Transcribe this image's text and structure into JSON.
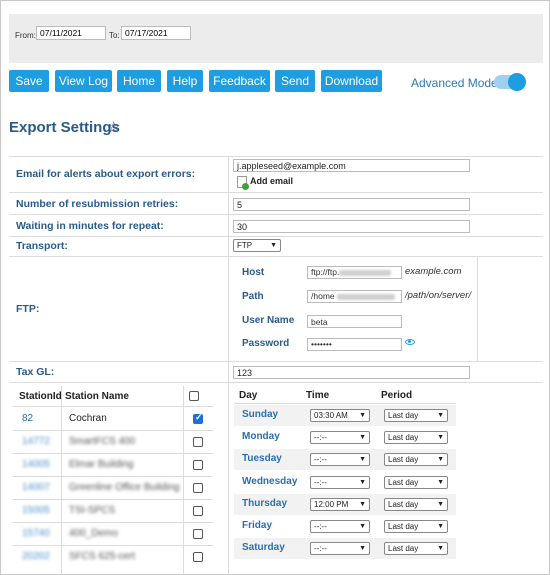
{
  "date_range": {
    "from_label": "From:",
    "from_value": "07/11/2021",
    "to_label": "To:",
    "to_value": "07/17/2021"
  },
  "toolbar": {
    "buttons": [
      "Save",
      "View Log",
      "Home",
      "Help",
      "Feedback",
      "Send",
      "Download"
    ],
    "advanced_mode_label": "Advanced Mode",
    "advanced_mode_on": true
  },
  "page": {
    "title": "Export Settings"
  },
  "settings": {
    "email_label": "Email for alerts about export errors:",
    "email_value": "j.appleseed@example.com",
    "add_email_label": "Add email",
    "retries_label": "Number of resubmission retries:",
    "retries_value": "5",
    "wait_label": "Waiting in minutes for repeat:",
    "wait_value": "30",
    "transport_label": "Transport:",
    "transport_value": "FTP",
    "ftp_label": "FTP:",
    "taxgl_label": "Tax GL:",
    "taxgl_value": "123"
  },
  "ftp": {
    "host_label": "Host",
    "host_value": "ftp://ftp.",
    "host_suffix": "example.com",
    "path_label": "Path",
    "path_value": "/home",
    "path_suffix": "/path/on/server/",
    "user_label": "User Name",
    "user_value": "beta",
    "password_label": "Password",
    "password_value": "•••••••"
  },
  "stations": {
    "col_id": "StationId",
    "col_name": "Station Name",
    "rows": [
      {
        "id": "82",
        "name": "Cochran",
        "checked": true
      },
      {
        "id": "14772",
        "name": "SmartFCS 400",
        "checked": false
      },
      {
        "id": "14005",
        "name": "Elmar Building",
        "checked": false
      },
      {
        "id": "14007",
        "name": "Greenline Office Building",
        "checked": false
      },
      {
        "id": "15005",
        "name": "TSI-SPCS",
        "checked": false
      },
      {
        "id": "15740",
        "name": "400_Demo",
        "checked": false
      },
      {
        "id": "20202",
        "name": "SFCS 625-cert",
        "checked": false
      }
    ]
  },
  "schedule": {
    "col_day": "Day",
    "col_time": "Time",
    "col_period": "Period",
    "rows": [
      {
        "day": "Sunday",
        "time": "03:30 AM",
        "period": "Last day"
      },
      {
        "day": "Monday",
        "time": "--:--",
        "period": "Last day"
      },
      {
        "day": "Tuesday",
        "time": "--:--",
        "period": "Last day"
      },
      {
        "day": "Wednesday",
        "time": "--:--",
        "period": "Last day"
      },
      {
        "day": "Thursday",
        "time": "12:00 PM",
        "period": "Last day"
      },
      {
        "day": "Friday",
        "time": "--:--",
        "period": "Last day"
      },
      {
        "day": "Saturday",
        "time": "--:--",
        "period": "Last day"
      }
    ]
  }
}
